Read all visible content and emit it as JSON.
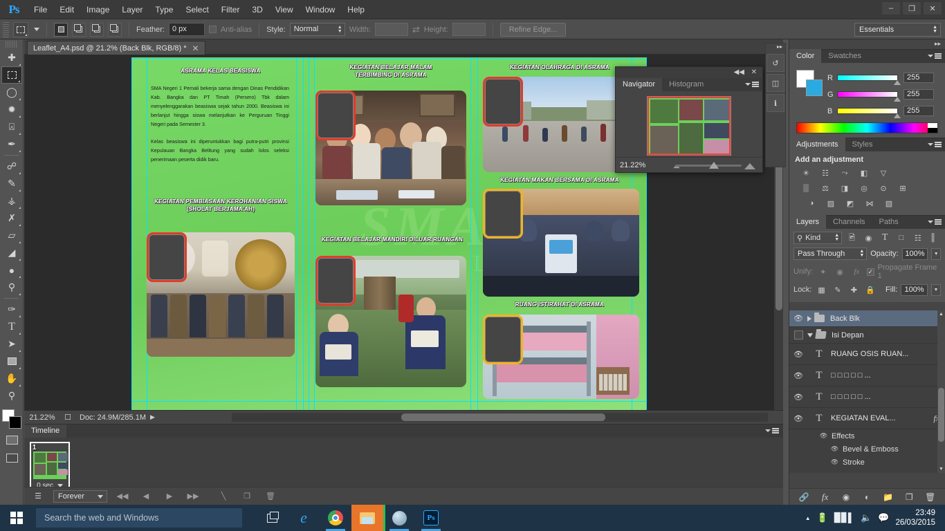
{
  "app": {
    "logo": "Ps",
    "title": "Adobe Photoshop"
  },
  "menubar": {
    "items": [
      "File",
      "Edit",
      "Image",
      "Layer",
      "Type",
      "Select",
      "Filter",
      "3D",
      "View",
      "Window",
      "Help"
    ],
    "window_controls": {
      "minimize": "–",
      "restore": "❐",
      "close": "✕"
    }
  },
  "options_bar": {
    "tool_name": "rectangular-marquee",
    "feather_label": "Feather:",
    "feather_value": "0 px",
    "antialias_label": "Anti-alias",
    "style_label": "Style:",
    "style_value": "Normal",
    "width_label": "Width:",
    "width_value": "",
    "height_label": "Height:",
    "height_value": "",
    "refine_edge": "Refine Edge...",
    "workspace": "Essentials"
  },
  "toolbar": {
    "tools": [
      {
        "name": "move-tool",
        "glyph": "✛"
      },
      {
        "name": "rectangular-marquee-tool",
        "glyph": "⬚"
      },
      {
        "name": "lasso-tool",
        "glyph": "➦"
      },
      {
        "name": "quick-selection-tool",
        "glyph": "❁"
      },
      {
        "name": "crop-tool",
        "glyph": "⌗"
      },
      {
        "name": "eyedropper-tool",
        "glyph": "✒"
      },
      {
        "name": "spot-healing-brush-tool",
        "glyph": "⚕"
      },
      {
        "name": "brush-tool",
        "glyph": "✎"
      },
      {
        "name": "clone-stamp-tool",
        "glyph": "⌘"
      },
      {
        "name": "history-brush-tool",
        "glyph": "✇"
      },
      {
        "name": "eraser-tool",
        "glyph": "▱"
      },
      {
        "name": "gradient-tool",
        "glyph": "■"
      },
      {
        "name": "blur-tool",
        "glyph": "●"
      },
      {
        "name": "dodge-tool",
        "glyph": "○"
      },
      {
        "name": "pen-tool",
        "glyph": "✑"
      },
      {
        "name": "type-tool",
        "glyph": "T"
      },
      {
        "name": "path-selection-tool",
        "glyph": "➤"
      },
      {
        "name": "rectangle-tool",
        "glyph": "■"
      },
      {
        "name": "hand-tool",
        "glyph": "✋"
      },
      {
        "name": "zoom-tool",
        "glyph": "⌕"
      }
    ],
    "foreground_color": "#ffffff",
    "background_color": "#000000"
  },
  "document": {
    "tab_title": "Leaflet_A4.psd @ 21.2% (Back Blk, RGB/8) *",
    "close_glyph": "✕"
  },
  "canvas": {
    "watermark": "SMA",
    "watermark_sub": "PEMALI",
    "headings": {
      "asrama": "ASRAMA KELAS BEASISWA",
      "belajar_malam_l1": "KEGIATAN BELAJAR MALAM",
      "belajar_malam_l2": "TERBIMBING DI ASRAMA",
      "olahraga": "KEGIATAN OLAHRAGA DI ASRAMA",
      "makan": "KEGIATAN MAKAN BERSAMA DI ASRAMA",
      "istirahat": "RUANG ISTIRAHAT DI ASRAMA",
      "kerohanian_l1": "KEGIATAN PEMBIASAAN KEROHANIAN SISWA",
      "kerohanian_l2": "(SHOLAT BERJAMA’AH)",
      "mandiri": "KEGIATAN BELAJAR MANDIRI DILUAR RUANGAN"
    },
    "body_p1": "SMA Negeri 1 Pemali bekerja sama dengan Dinas Pendidikan Kab. Bangka dan PT Timah (Persero) Tbk dalam menyelenggarakan beasiswa sejak tahun 2000. Beasiswa ini berlanjut hingga siswa melanjutkan ke Perguruan Tinggi Negeri pada Semester 3.",
    "body_p2": "Kelas beasiswa ini diperuntukkan bagi putra-putri provinsi Kepulauan Bangka Belitung yang sudah lolos seleksi penerimaan peserta didik baru."
  },
  "status_bar": {
    "zoom": "21.22%",
    "doc_label": "Doc: 24.9M/285.1M"
  },
  "navigator": {
    "tabs": [
      "Navigator",
      "Histogram"
    ],
    "active_tab": "Navigator",
    "zoom_value": "21.22%",
    "collapse_glyph": "◀◀",
    "close_glyph": "✕"
  },
  "color_panel": {
    "tabs": [
      "Color",
      "Swatches"
    ],
    "active_tab": "Color",
    "channels": [
      {
        "label": "R",
        "value": "255"
      },
      {
        "label": "G",
        "value": "255"
      },
      {
        "label": "B",
        "value": "255"
      }
    ]
  },
  "adjustments_panel": {
    "tabs": [
      "Adjustments",
      "Styles"
    ],
    "active_tab": "Adjustments",
    "heading": "Add an adjustment",
    "rows": [
      [
        {
          "name": "brightness-contrast-icon",
          "glyph": "☀"
        },
        {
          "name": "levels-icon",
          "glyph": "☷"
        },
        {
          "name": "curves-icon",
          "glyph": "⤳"
        },
        {
          "name": "exposure-icon",
          "glyph": "◧"
        },
        {
          "name": "vibrance-icon",
          "glyph": "▽"
        }
      ],
      [
        {
          "name": "hue-saturation-icon",
          "glyph": "▒"
        },
        {
          "name": "color-balance-icon",
          "glyph": "⚖"
        },
        {
          "name": "black-white-icon",
          "glyph": "◨"
        },
        {
          "name": "photo-filter-icon",
          "glyph": "◎"
        },
        {
          "name": "channel-mixer-icon",
          "glyph": "⊙"
        },
        {
          "name": "color-lookup-icon",
          "glyph": "⊞"
        }
      ],
      [
        {
          "name": "invert-icon",
          "glyph": "◑"
        },
        {
          "name": "posterize-icon",
          "glyph": "▨"
        },
        {
          "name": "threshold-icon",
          "glyph": "◩"
        },
        {
          "name": "gradient-map-icon",
          "glyph": "⋈"
        },
        {
          "name": "selective-color-icon",
          "glyph": "▧"
        }
      ]
    ]
  },
  "layers_panel": {
    "tabs": [
      "Layers",
      "Channels",
      "Paths"
    ],
    "active_tab": "Layers",
    "filter_kind": "Kind",
    "filter_icons": [
      "pixel-filter",
      "adjustment-filter",
      "type-filter",
      "shape-filter",
      "smart-object-filter"
    ],
    "blend_mode": "Pass Through",
    "opacity_label": "Opacity:",
    "opacity_value": "100%",
    "unify_label": "Unify:",
    "propagate_label": "Propagate Frame 1",
    "lock_label": "Lock:",
    "fill_label": "Fill:",
    "fill_value": "100%",
    "layers": [
      {
        "name": "Back Blk",
        "type": "group",
        "visible": true,
        "selected": true,
        "expanded": false
      },
      {
        "name": "Isi Depan",
        "type": "group",
        "visible": false,
        "selected": false,
        "expanded": true
      },
      {
        "name": "RUANG OSIS RUAN...",
        "type": "text",
        "visible": true,
        "selected": false
      },
      {
        "name": "□ □ □ □ □ ...",
        "type": "text",
        "visible": true,
        "selected": false
      },
      {
        "name": "□ □ □ □ □ ...",
        "type": "text",
        "visible": true,
        "selected": false
      },
      {
        "name": "KEGIATAN EVAL...",
        "type": "text",
        "visible": true,
        "selected": false,
        "has_fx": true
      }
    ],
    "effects": [
      {
        "name": "Effects",
        "indent": 1
      },
      {
        "name": "Bevel & Emboss",
        "indent": 2
      },
      {
        "name": "Stroke",
        "indent": 2
      }
    ],
    "footer_icons": [
      "link-layers",
      "add-layer-style",
      "add-layer-mask",
      "new-adjustment-layer",
      "new-group",
      "new-layer",
      "delete-layer"
    ]
  },
  "timeline": {
    "tab": "Timeline",
    "frame_number": "1",
    "frame_delay": "0 sec.",
    "loop_option": "Forever",
    "controls": [
      "select-first-frame",
      "select-previous-frame",
      "play-animation",
      "select-next-frame",
      "tween-frames",
      "duplicate-frame",
      "delete-frame"
    ]
  },
  "taskbar": {
    "search_placeholder": "Search the web and Windows",
    "apps": [
      {
        "name": "task-view-icon"
      },
      {
        "name": "internet-explorer-icon",
        "glyph": "e"
      },
      {
        "name": "google-chrome-icon"
      },
      {
        "name": "file-explorer-icon"
      },
      {
        "name": "browser-icon"
      },
      {
        "name": "photoshop-icon",
        "glyph": "Ps"
      }
    ],
    "tray": {
      "show_hidden": "▲",
      "battery": "battery-icon",
      "network": "network-icon",
      "volume": "volume-icon",
      "action_center": "action-center-icon"
    },
    "time": "23:49",
    "date": "26/03/2015"
  },
  "colors": {
    "chrome_bg": "#535353",
    "panel_bg": "#454545",
    "dark_bg": "#2b2b2b",
    "accent_blue": "#31a8ff",
    "canvas_green": "#6bd05a",
    "selection_blue": "#5b6b7f",
    "taskbar_blue": "#1f3346"
  }
}
